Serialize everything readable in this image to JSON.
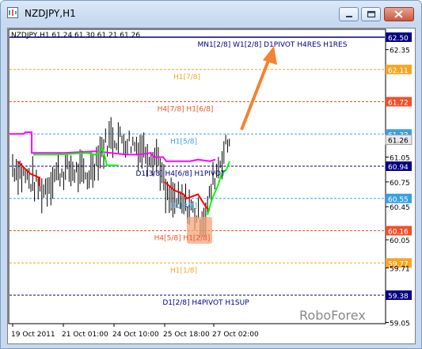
{
  "window": {
    "title": "NZDJPY,H1"
  },
  "chart": {
    "info_line": "NZDJPY,H1  61.24 61.30 61.21 61.26",
    "watermark": "RoboForex",
    "current_price": "61.26",
    "colors": {
      "background": "#ffffff",
      "bars": "#000000",
      "magenta_line": "#ff00ff",
      "green_line": "#00ff00",
      "red_line": "#ff0000",
      "arrow": "#f58231",
      "highlight_box": "#f4a57a"
    },
    "levels": [
      {
        "label": "MN1[2/8] W1[2/8] D1PIVOT H4RES H1RES",
        "price": "62.50",
        "color": "#000080",
        "style": "solid"
      },
      {
        "label": "H1[7/8]",
        "price": "62.11",
        "color": "#f5a623",
        "style": "dashed"
      },
      {
        "label": "H4[7/8] H1[6/8]",
        "price": "61.72",
        "color": "#f0502a",
        "style": "dashed"
      },
      {
        "label": "H1[5/8]",
        "price": "61.33",
        "color": "#3aa0e0",
        "style": "dashed"
      },
      {
        "label": "D1[3/8] H4[6/8] H1PIVOT",
        "price": "60.94",
        "color": "#000080",
        "style": "dashed"
      },
      {
        "label": "H1[3/8]",
        "price": "60.55",
        "color": "#3aa0e0",
        "style": "dashed"
      },
      {
        "label": "H4[5/8] H1[2/8]",
        "price": "60.16",
        "color": "#f0502a",
        "style": "dashed"
      },
      {
        "label": "H1[1/8]",
        "price": "59.77",
        "color": "#f5a623",
        "style": "dashed"
      },
      {
        "label": "D1[2/8] H4PIVOT H1SUP",
        "price": "59.38",
        "color": "#000080",
        "style": "dashed"
      }
    ],
    "y_ticks": [
      "62.35",
      "61.05",
      "60.75",
      "60.45",
      "60.05",
      "59.71",
      "59.05"
    ],
    "x_labels": [
      "19 Oct 2011",
      "21 Oct 01:00",
      "24 Oct 10:00",
      "25 Oct 18:00",
      "27 Oct 02:00"
    ]
  }
}
